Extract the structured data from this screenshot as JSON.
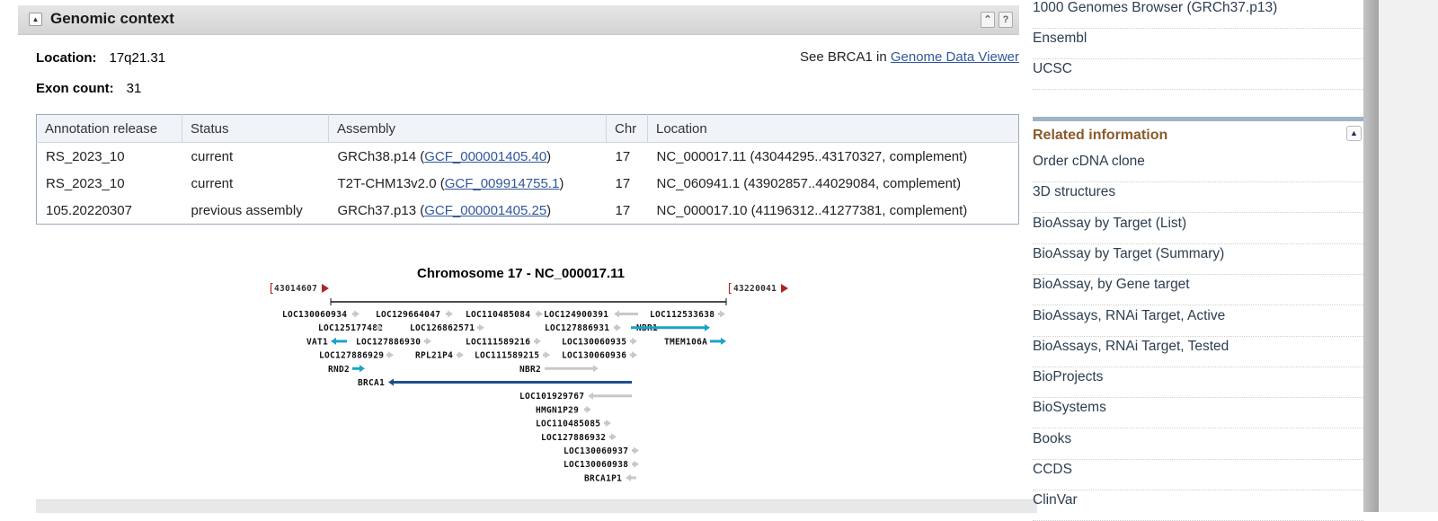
{
  "section": {
    "title": "Genomic context",
    "collapse_icon": "▲",
    "scroll_top_icon": "⌃",
    "help_icon": "?"
  },
  "summary": {
    "location_label": "Location:",
    "location_value": "17q21.31",
    "exon_label": "Exon count:",
    "exon_value": "31",
    "gdv_prefix": "See BRCA1 in ",
    "gdv_link": "Genome Data Viewer"
  },
  "table": {
    "headers": [
      "Annotation release",
      "Status",
      "Assembly",
      "Chr",
      "Location"
    ],
    "rows": [
      {
        "release": "RS_2023_10",
        "status": "current",
        "assembly": "GRCh38.p14",
        "accession": "GCF_000001405.40",
        "chr": "17",
        "location": "NC_000017.11 (43044295..43170327, complement)"
      },
      {
        "release": "RS_2023_10",
        "status": "current",
        "assembly": "T2T-CHM13v2.0",
        "accession": "GCF_009914755.1",
        "chr": "17",
        "location": "NC_060941.1 (43902857..44029084, complement)"
      },
      {
        "release": "105.20220307",
        "status": "previous assembly",
        "assembly": "GRCh37.p13",
        "accession": "GCF_000001405.25",
        "chr": "17",
        "location": "NC_000017.10 (41196312..41277381, complement)"
      }
    ]
  },
  "diagram": {
    "title": "Chromosome 17 - NC_000017.11",
    "range_start": "43014607",
    "range_end": "43220041",
    "colors": {
      "gray": "#c8c8c8",
      "cyan": "#1aa3c9",
      "navy": "#1f4e8c",
      "bracket": "#b22222"
    },
    "genes": [
      {
        "label": "LOC130060934",
        "row": 0,
        "dir": "right",
        "color": "gray"
      },
      {
        "label": "LOC129664047",
        "row": 0,
        "dir": "right",
        "color": "gray"
      },
      {
        "label": "LOC110485084",
        "row": 0,
        "dir": "right",
        "color": "gray"
      },
      {
        "label": "LOC124900391",
        "row": 0,
        "dir": "left",
        "color": "gray"
      },
      {
        "label": "LOC112533638",
        "row": 0,
        "dir": "right",
        "color": "gray"
      },
      {
        "label": "LOC125177482",
        "row": 1,
        "dir": "right",
        "color": "gray"
      },
      {
        "label": "LOC126862571",
        "row": 1,
        "dir": "right",
        "color": "gray"
      },
      {
        "label": "LOC127886931",
        "row": 1,
        "dir": "right",
        "color": "gray"
      },
      {
        "label": "NBR1",
        "row": 1,
        "dir": "right",
        "color": "cyan"
      },
      {
        "label": "VAT1",
        "row": 2,
        "dir": "left",
        "color": "cyan"
      },
      {
        "label": "LOC127886930",
        "row": 2,
        "dir": "right",
        "color": "gray"
      },
      {
        "label": "LOC111589216",
        "row": 2,
        "dir": "right",
        "color": "gray"
      },
      {
        "label": "LOC130060935",
        "row": 2,
        "dir": "right",
        "color": "gray"
      },
      {
        "label": "TMEM106A",
        "row": 2,
        "dir": "right",
        "color": "cyan"
      },
      {
        "label": "LOC127886929",
        "row": 3,
        "dir": "right",
        "color": "gray"
      },
      {
        "label": "RPL21P4",
        "row": 3,
        "dir": "right",
        "color": "gray"
      },
      {
        "label": "LOC111589215",
        "row": 3,
        "dir": "right",
        "color": "gray"
      },
      {
        "label": "LOC130060936",
        "row": 3,
        "dir": "right",
        "color": "gray"
      },
      {
        "label": "RND2",
        "row": 4,
        "dir": "right",
        "color": "cyan"
      },
      {
        "label": "NBR2",
        "row": 4,
        "dir": "right",
        "color": "gray"
      },
      {
        "label": "BRCA1",
        "row": 5,
        "dir": "left",
        "color": "navy"
      },
      {
        "label": "LOC101929767",
        "row": 6,
        "dir": "left",
        "color": "gray"
      },
      {
        "label": "HMGN1P29",
        "row": 7,
        "dir": "right",
        "color": "gray"
      },
      {
        "label": "LOC110485085",
        "row": 8,
        "dir": "right",
        "color": "gray"
      },
      {
        "label": "LOC127886932",
        "row": 9,
        "dir": "right",
        "color": "gray"
      },
      {
        "label": "LOC130060937",
        "row": 10,
        "dir": "right",
        "color": "gray"
      },
      {
        "label": "LOC130060938",
        "row": 11,
        "dir": "right",
        "color": "gray"
      },
      {
        "label": "BRCA1P1",
        "row": 12,
        "dir": "left",
        "color": "gray"
      }
    ]
  },
  "sidebar": {
    "top_links": [
      "1000 Genomes Browser (GRCh37.p13)",
      "Ensembl",
      "UCSC"
    ],
    "related_title": "Related information",
    "related_toggle_icon": "▲",
    "related_links": [
      "Order cDNA clone",
      "3D structures",
      "BioAssay by Target (List)",
      "BioAssay by Target (Summary)",
      "BioAssay, by Gene target",
      "BioAssays, RNAi Target, Active",
      "BioAssays, RNAi Target, Tested",
      "BioProjects",
      "BioSystems",
      "Books",
      "CCDS",
      "ClinVar"
    ]
  }
}
